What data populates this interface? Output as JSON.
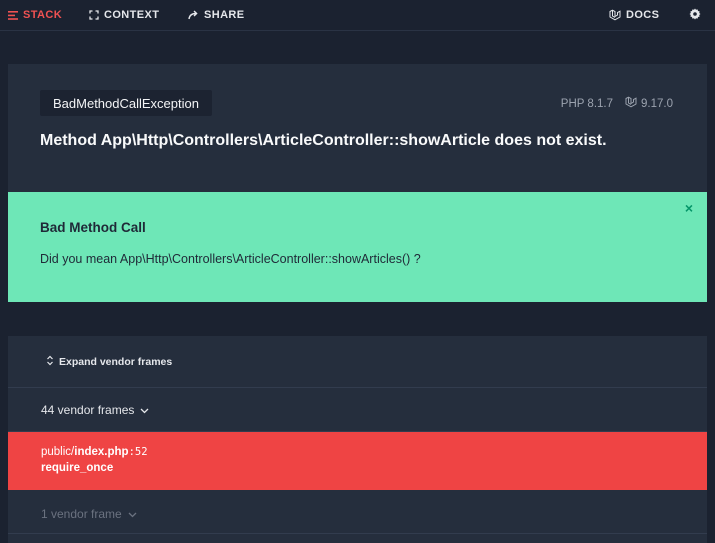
{
  "nav": {
    "stack": "STACK",
    "context": "CONTEXT",
    "share": "SHARE",
    "docs": "DOCS"
  },
  "header": {
    "exception_class": "BadMethodCallException",
    "php_version": "PHP 8.1.7",
    "laravel_version": "9.17.0",
    "message": "Method App\\Http\\Controllers\\ArticleController::showArticle does not exist."
  },
  "solution": {
    "title": "Bad Method Call",
    "description": "Did you mean App\\Http\\Controllers\\ArticleController::showArticles() ?",
    "close": "×"
  },
  "stack": {
    "expand_label": "Expand vendor frames",
    "vendor_frames_label": "44 vendor frames",
    "frame": {
      "dir": "public/",
      "file": "index.php",
      "line": ":52",
      "function": "require_once"
    },
    "vendor_frames_2_label": "1 vendor frame"
  },
  "colors": {
    "accent_red": "#ef4444",
    "solution_green": "#6ee7b7",
    "panel_bg": "#252e3d",
    "page_bg": "#1b2230"
  },
  "icons": [
    "stack-icon",
    "expand-icon",
    "share-icon",
    "laravel-icon",
    "gear-icon",
    "chevron-down-icon",
    "chevron-up-down-icon",
    "close-icon"
  ]
}
